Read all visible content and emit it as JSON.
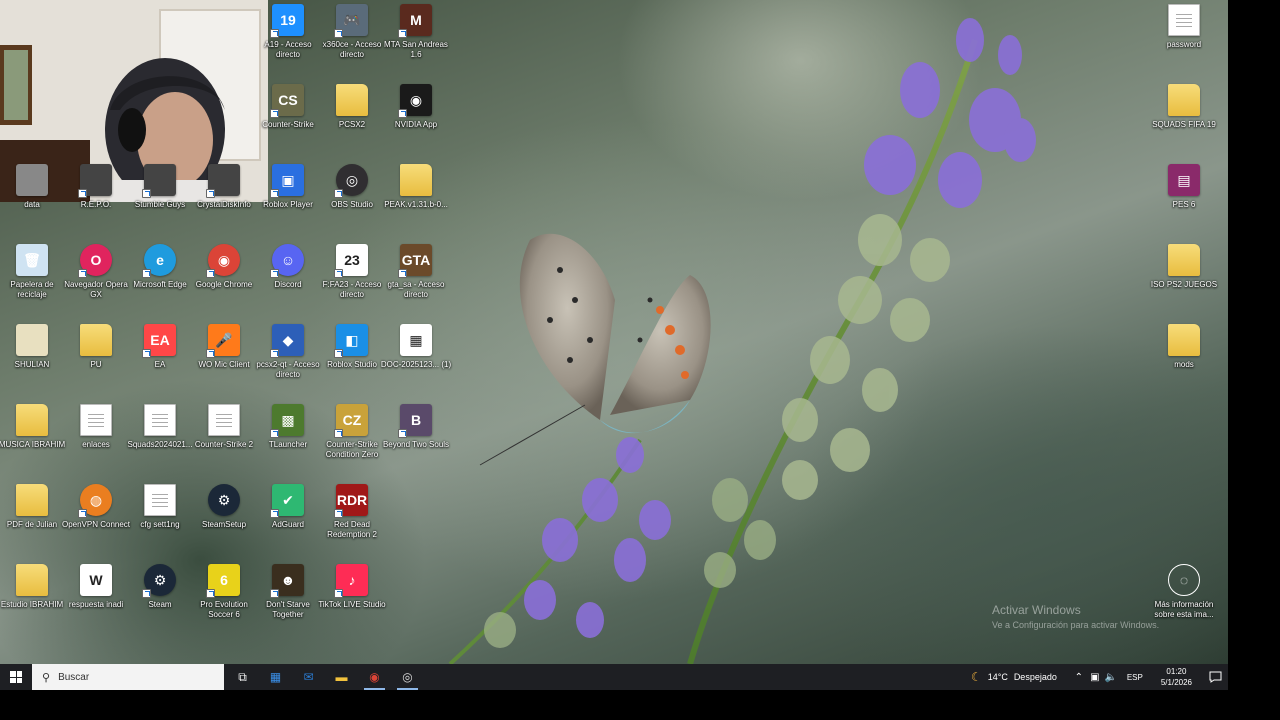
{
  "desktop": {
    "icons": [
      {
        "label": "A19 - Acceso directo",
        "icon": "a19-icon",
        "color": "#1e90ff",
        "glyph": "19",
        "shortcut": true
      },
      {
        "label": "x360ce - Acceso directo",
        "icon": "gamepad-icon",
        "color": "#5a6b7a",
        "glyph": "🎮",
        "shortcut": true
      },
      {
        "label": "MTA San Andreas 1.6",
        "icon": "mta-icon",
        "color": "#5a2a1e",
        "glyph": "M",
        "shortcut": true
      },
      {
        "label": "Counter-Strike",
        "icon": "counter-strike-icon",
        "color": "#6b6b4a",
        "glyph": "CS",
        "shortcut": true
      },
      {
        "label": "PCSX2",
        "icon": "folder-icon",
        "color": "#e8bd3f",
        "glyph": "",
        "shortcut": false
      },
      {
        "label": "NVIDIA App",
        "icon": "nvidia-icon",
        "color": "#1a1a1a",
        "glyph": "◉",
        "shortcut": true
      },
      {
        "label": "data",
        "icon": "data-icon",
        "color": "#888888",
        "glyph": "",
        "shortcut": false
      },
      {
        "label": "R.E.P.O.",
        "icon": "repo-icon",
        "color": "#444444",
        "glyph": "",
        "shortcut": true
      },
      {
        "label": "Stumble Guys",
        "icon": "stumble-guys-icon",
        "color": "#444444",
        "glyph": "",
        "shortcut": true
      },
      {
        "label": "CrystalDiskInfo",
        "icon": "crystaldiskinfo-icon",
        "color": "#444444",
        "glyph": "",
        "shortcut": true
      },
      {
        "label": "Roblox Player",
        "icon": "roblox-icon",
        "color": "#2a6fe0",
        "glyph": "▣",
        "shortcut": true
      },
      {
        "label": "OBS Studio",
        "icon": "obs-icon",
        "color": "#302e31",
        "glyph": "◎",
        "shortcut": true
      },
      {
        "label": "PEAK.v1.31.b-0...",
        "icon": "folder-icon",
        "color": "#e8bd3f",
        "glyph": "",
        "shortcut": false
      },
      {
        "label": "Papelera de reciclaje",
        "icon": "recycle-bin-icon",
        "color": "#cfe3f2",
        "glyph": "🗑",
        "shortcut": false
      },
      {
        "label": "Navegador Opera GX",
        "icon": "opera-gx-icon",
        "color": "#e0245e",
        "glyph": "O",
        "shortcut": true
      },
      {
        "label": "Microsoft Edge",
        "icon": "edge-icon",
        "color": "#1f9bde",
        "glyph": "e",
        "shortcut": true
      },
      {
        "label": "Google Chrome",
        "icon": "chrome-icon",
        "color": "#db4437",
        "glyph": "◉",
        "shortcut": true
      },
      {
        "label": "Discord",
        "icon": "discord-icon",
        "color": "#5865f2",
        "glyph": "☺",
        "shortcut": true
      },
      {
        "label": "F:FA23 - Acceso directo",
        "icon": "fifa23-icon",
        "color": "#ffffff",
        "glyph": "23",
        "shortcut": true
      },
      {
        "label": "gta_sa - Acceso directo",
        "icon": "gta-sa-icon",
        "color": "#6b4a2a",
        "glyph": "GTA",
        "shortcut": true
      },
      {
        "label": "SHULIAN",
        "icon": "shulian-icon",
        "color": "#e8e0c0",
        "glyph": "",
        "shortcut": false
      },
      {
        "label": "PU",
        "icon": "folder-icon",
        "color": "#e8bd3f",
        "glyph": "",
        "shortcut": false
      },
      {
        "label": "EA",
        "icon": "ea-icon",
        "color": "#ff4747",
        "glyph": "EA",
        "shortcut": true
      },
      {
        "label": "WO Mic Client",
        "icon": "microphone-icon",
        "color": "#ff7a1a",
        "glyph": "🎤",
        "shortcut": true
      },
      {
        "label": "pcsx2-qt - Acceso directo",
        "icon": "pcsx2-icon",
        "color": "#2d5fb8",
        "glyph": "◆",
        "shortcut": true
      },
      {
        "label": "Roblox Studio",
        "icon": "roblox-studio-icon",
        "color": "#1a8fe6",
        "glyph": "◧",
        "shortcut": true
      },
      {
        "label": "DOC-2025123... (1)",
        "icon": "spreadsheet-icon",
        "color": "#ffffff",
        "glyph": "▦",
        "shortcut": false
      },
      {
        "label": "MUSICA IBRAHIM",
        "icon": "folder-icon",
        "color": "#e8bd3f",
        "glyph": "",
        "shortcut": false
      },
      {
        "label": "enlaces",
        "icon": "document-icon",
        "color": "#ffffff",
        "glyph": "",
        "shortcut": false
      },
      {
        "label": "Squads2024021...",
        "icon": "file-icon",
        "color": "#ffffff",
        "glyph": "",
        "shortcut": false
      },
      {
        "label": "Counter-Strike 2",
        "icon": "file-icon",
        "color": "#ffffff",
        "glyph": "",
        "shortcut": false
      },
      {
        "label": "TLauncher",
        "icon": "tlauncher-icon",
        "color": "#4d7a2e",
        "glyph": "▩",
        "shortcut": true
      },
      {
        "label": "Counter-Strike Condition Zero",
        "icon": "cs-condition-zero-icon",
        "color": "#c9a23a",
        "glyph": "CZ",
        "shortcut": true
      },
      {
        "label": "Beyond Two Souls",
        "icon": "beyond-two-souls-icon",
        "color": "#5a4a6a",
        "glyph": "B",
        "shortcut": true
      },
      {
        "label": "PDF de Julian",
        "icon": "folder-icon",
        "color": "#e8bd3f",
        "glyph": "",
        "shortcut": false
      },
      {
        "label": "OpenVPN Connect",
        "icon": "openvpn-icon",
        "color": "#ea7e20",
        "glyph": "◍",
        "shortcut": true
      },
      {
        "label": "cfg sett1ng",
        "icon": "document-icon",
        "color": "#ffffff",
        "glyph": "",
        "shortcut": false
      },
      {
        "label": "SteamSetup",
        "icon": "steam-setup-icon",
        "color": "#1b2838",
        "glyph": "⚙",
        "shortcut": false
      },
      {
        "label": "AdGuard",
        "icon": "adguard-icon",
        "color": "#2eb872",
        "glyph": "✔",
        "shortcut": true
      },
      {
        "label": "Red Dead Redemption 2",
        "icon": "rdr2-icon",
        "color": "#a01818",
        "glyph": "RDR",
        "shortcut": true
      },
      {
        "label": "Estudio IBRAHIM",
        "icon": "folder-icon",
        "color": "#e8bd3f",
        "glyph": "",
        "shortcut": false
      },
      {
        "label": "respuesta inadi",
        "icon": "word-document-icon",
        "color": "#ffffff",
        "glyph": "W",
        "shortcut": false
      },
      {
        "label": "Steam",
        "icon": "steam-icon",
        "color": "#1b2838",
        "glyph": "⚙",
        "shortcut": true
      },
      {
        "label": "Pro Evolution Soccer 6",
        "icon": "pes6-icon",
        "color": "#e8d21a",
        "glyph": "6",
        "shortcut": true
      },
      {
        "label": "Don't Starve Together",
        "icon": "dont-starve-icon",
        "color": "#3a2e1e",
        "glyph": "☻",
        "shortcut": true
      },
      {
        "label": "TikTok LIVE Studio",
        "icon": "tiktok-live-icon",
        "color": "#fe2c55",
        "glyph": "♪",
        "shortcut": true
      },
      {
        "label": "password",
        "icon": "document-icon",
        "color": "#ffffff",
        "glyph": "",
        "shortcut": false
      },
      {
        "label": "SQUADS FIFA 19",
        "icon": "folder-icon",
        "color": "#e8bd3f",
        "glyph": "",
        "shortcut": false
      },
      {
        "label": "PES 6",
        "icon": "winrar-icon",
        "color": "#8a2a6a",
        "glyph": "▤",
        "shortcut": false
      },
      {
        "label": "ISO PS2 JUEGOS",
        "icon": "folder-icon",
        "color": "#e8bd3f",
        "glyph": "",
        "shortcut": false
      },
      {
        "label": "mods",
        "icon": "folder-icon",
        "color": "#e8bd3f",
        "glyph": "",
        "shortcut": false
      },
      {
        "label": "Más información sobre esta ima...",
        "icon": "camera-info-icon",
        "color": "transparent",
        "glyph": "◌",
        "shortcut": false
      }
    ]
  },
  "watermark": {
    "title": "Activar Windows",
    "subtitle": "Ve a Configuración para activar Windows."
  },
  "taskbar": {
    "search_placeholder": "Buscar",
    "apps": [
      {
        "name": "task-view-button",
        "glyph": "⧉",
        "active": false
      },
      {
        "name": "microsoft-store-button",
        "glyph": "▦",
        "active": false
      },
      {
        "name": "outlook-button",
        "glyph": "✉",
        "active": false
      },
      {
        "name": "file-explorer-button",
        "glyph": "▬",
        "active": false
      },
      {
        "name": "chrome-taskbar-button",
        "glyph": "◉",
        "active": true
      },
      {
        "name": "obs-taskbar-button",
        "glyph": "◎",
        "active": true
      }
    ],
    "weather": {
      "temp": "14°C",
      "condition": "Despejado"
    },
    "language": "ESP",
    "time": "01:20",
    "date": "5/1/2026"
  }
}
